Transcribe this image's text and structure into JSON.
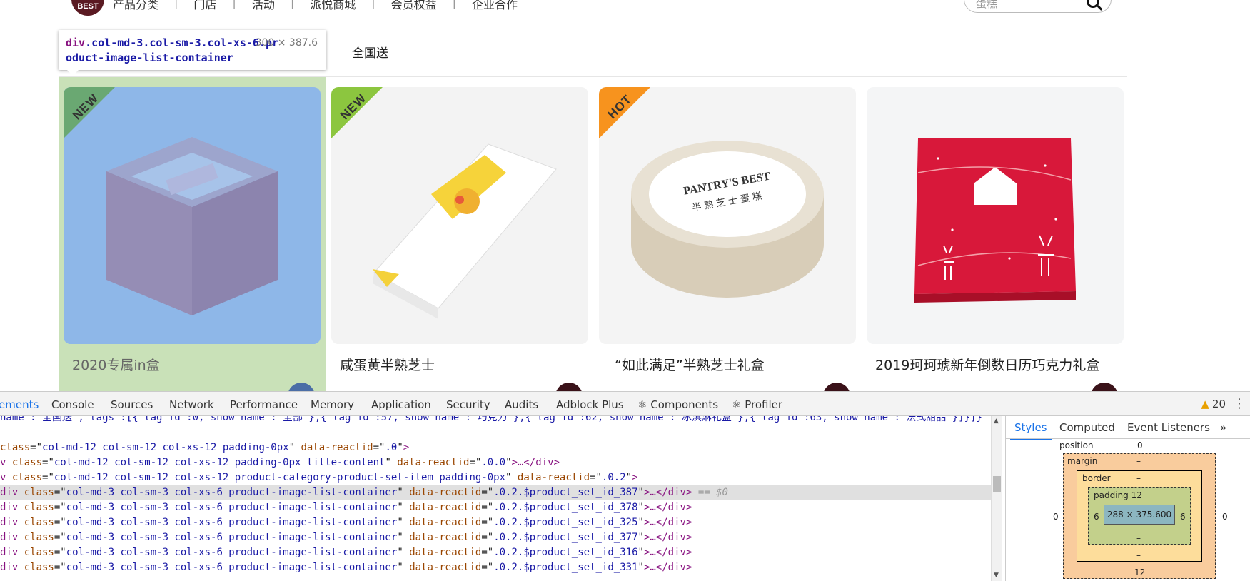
{
  "site_nav": {
    "logo_text": "BEST",
    "items": [
      "产品分类",
      "门店",
      "活动",
      "派悦商城",
      "会员权益",
      "企业合作"
    ],
    "search_placeholder": "蛋糕"
  },
  "inspector_tooltip": {
    "tag": "div",
    "classes_line1": ".col-md-3.col-sm-3.col-xs-6.pr",
    "classes_line2": "oduct-image-list-container",
    "size": "300 × 387.6"
  },
  "category_tab": "全国送",
  "products": [
    {
      "name": "2020专属in盒",
      "badge": "NEW",
      "badge_color": "#8cc63f",
      "selected": true
    },
    {
      "name": "咸蛋黄半熟芝士",
      "badge": "NEW",
      "badge_color": "#8cc63f",
      "selected": false
    },
    {
      "name": "“如此满足”半熟芝士礼盒",
      "badge": "HOT",
      "badge_color": "#f7931e",
      "selected": false
    },
    {
      "name": "2019珂珂琥新年倒数日历巧克力礼盒",
      "badge": "",
      "badge_color": "",
      "selected": false
    }
  ],
  "devtools": {
    "tabs": [
      "Elements",
      "Console",
      "Sources",
      "Network",
      "Performance",
      "Memory",
      "Application",
      "Security",
      "Audits",
      "Adblock Plus",
      "Components",
      "Profiler"
    ],
    "tab_display": [
      "ements",
      "Console",
      "Sources",
      "Network",
      "Performance",
      "Memory",
      "Application",
      "Security",
      "Audits",
      "Adblock Plus",
      "⚛ Components",
      "⚛ Profiler"
    ],
    "warning_count": "20",
    "dom_lines": [
      {
        "text": "name\":\"全国送\",\"tags\":[{\"tag_id\":0,\"show_name\":\"全部\"},{\"tag_id\":57,\"show_name\":\"巧克力\"},{\"tag_id\":62,\"show_name\":\"冰淇淋礼盒\"},{\"tag_id\":63,\"show_name\":\"法式甜品\"}]}]}"
      },
      {
        "text": ""
      },
      {
        "prefix": "",
        "tag": "",
        "class": "col-md-12 col-sm-12 col-xs-12 padding-0px",
        "reactid": ".0",
        "end": ">"
      },
      {
        "prefix": "v ",
        "class": "col-md-12 col-sm-12 col-xs-12 padding-0px title-content",
        "reactid": ".0.0",
        "end": ">…</div>"
      },
      {
        "prefix": "v ",
        "class": "col-md-12 col-sm-12 col-xs-12 product-category-product-set-item padding-0px",
        "reactid": ".0.2",
        "end": ">"
      },
      {
        "prefix": "div ",
        "class": "col-md-3 col-sm-3 col-xs-6 product-image-list-container",
        "reactid": ".0.2.$product_set_id_387",
        "end": ">…</div>",
        "selected": true
      },
      {
        "prefix": "div ",
        "class": "col-md-3 col-sm-3 col-xs-6 product-image-list-container",
        "reactid": ".0.2.$product_set_id_378",
        "end": ">…</div>"
      },
      {
        "prefix": "div ",
        "class": "col-md-3 col-sm-3 col-xs-6 product-image-list-container",
        "reactid": ".0.2.$product_set_id_325",
        "end": ">…</div>"
      },
      {
        "prefix": "div ",
        "class": "col-md-3 col-sm-3 col-xs-6 product-image-list-container",
        "reactid": ".0.2.$product_set_id_377",
        "end": ">…</div>"
      },
      {
        "prefix": "div ",
        "class": "col-md-3 col-sm-3 col-xs-6 product-image-list-container",
        "reactid": ".0.2.$product_set_id_316",
        "end": ">…</div>"
      },
      {
        "prefix": "div ",
        "class": "col-md-3 col-sm-3 col-xs-6 product-image-list-container",
        "reactid": ".0.2.$product_set_id_331",
        "end": ">…</div>"
      }
    ],
    "selected_marker": "== $0",
    "side_tabs": [
      "Styles",
      "Computed",
      "Event Listeners",
      "»"
    ],
    "box_model": {
      "position_label": "position",
      "position_value": "0",
      "margin_label": "margin",
      "margin_top": "–",
      "margin_left": "0",
      "margin_right": "0",
      "margin_bottom": "12",
      "border_label": "border",
      "border_top": "–",
      "border_side": "–",
      "border_bottom": "–",
      "padding_label": "padding 12",
      "padding_left": "6",
      "padding_right": "6",
      "padding_bottom": "–",
      "content": "288 × 375.600"
    }
  }
}
